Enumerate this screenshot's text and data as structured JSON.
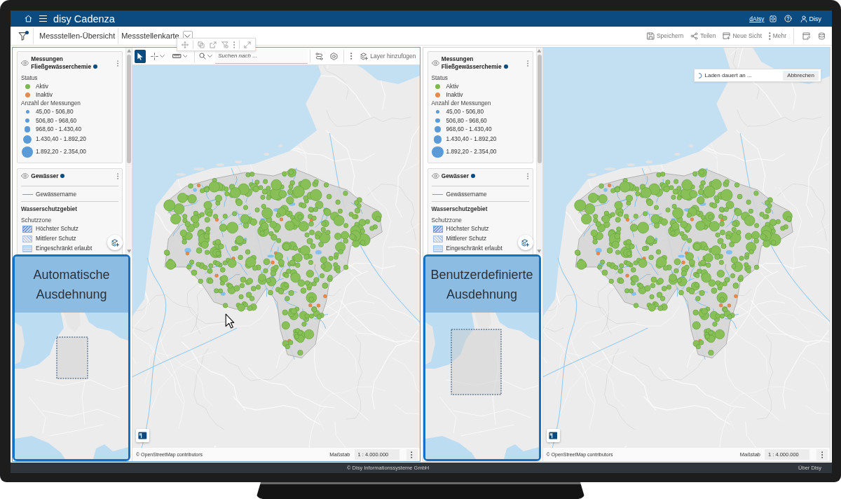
{
  "app_bar": {
    "title": "disy Cadenza",
    "assistant_link": "dAIsy",
    "user": "Disy"
  },
  "toolbar": {
    "filter_active": true,
    "breadcrumbs": [
      {
        "label": "Messstellen-Übersicht"
      },
      {
        "label": "Messstellenkarte"
      }
    ],
    "actions": [
      {
        "kind": "save",
        "label": "Speichern"
      },
      {
        "kind": "share",
        "label": "Teilen"
      },
      {
        "kind": "newview",
        "label": "Neue Sicht"
      },
      {
        "kind": "more",
        "label": "Mehr"
      }
    ]
  },
  "panels": [
    {
      "selected": true,
      "legend": [
        {
          "title": "Messungen Fließgewässerchemie",
          "visible": true,
          "status_dot": true,
          "sections": [
            {
              "title": "Status",
              "items": [
                {
                  "kind": "point",
                  "label": "Aktiv",
                  "color": "#7cb850"
                },
                {
                  "kind": "point",
                  "label": "Inaktiv",
                  "color": "#e98a48"
                }
              ]
            },
            {
              "title": "Anzahl der Messungen",
              "items": [
                {
                  "kind": "size",
                  "label": "45,00 - 506,80"
                },
                {
                  "kind": "size",
                  "label": "506,80 - 968,60"
                },
                {
                  "kind": "size",
                  "label": "968,60 - 1.430,40"
                },
                {
                  "kind": "size",
                  "label": "1.430,40 - 1.892,20"
                },
                {
                  "kind": "size",
                  "label": "1.892,20 - 2.354,00"
                }
              ]
            }
          ]
        },
        {
          "title": "Gewässer",
          "visible": true,
          "status_dot": true,
          "sublayers": [
            {
              "sections": [
                {
                  "items": [
                    {
                      "kind": "line",
                      "label": "Gewässername"
                    }
                  ]
                }
              ]
            },
            {
              "title": "Wasserschutzgebiet",
              "sections": [
                {
                  "title": "Schutzzone",
                  "items": [
                    {
                      "kind": "hatch",
                      "label": "Höchster Schutz"
                    },
                    {
                      "kind": "backhatch",
                      "label": "Mittlerer Schutz"
                    },
                    {
                      "kind": "stripes",
                      "label": "Eingeschränkt erlaubt"
                    }
                  ]
                }
              ]
            }
          ]
        }
      ],
      "map_toolbar": {
        "tools": [
          {
            "kind": "select",
            "selected": true
          },
          {
            "kind": "point",
            "selected": false
          },
          {
            "kind": "measure",
            "selected": false
          }
        ],
        "search": {
          "placeholder": "Suchen nach ..."
        },
        "add_layer": "Layer hinzufügen"
      },
      "overview": {
        "kind": "automatic",
        "caption": "Automatische Ausdehnung"
      },
      "attribution": "© OpenStreetMap contributors",
      "scale": {
        "label": "Maßstab",
        "value": "1 : 4.000.000"
      }
    },
    {
      "selected": false,
      "legend": [
        {
          "title": "Messungen Fließgewässerchemie",
          "visible": true,
          "status_dot": true,
          "sections": [
            {
              "title": "Status",
              "items": [
                {
                  "kind": "point",
                  "label": "Aktiv",
                  "color": "#7cb850"
                },
                {
                  "kind": "point",
                  "label": "Inaktiv",
                  "color": "#e98a48"
                }
              ]
            },
            {
              "title": "Anzahl der Messungen",
              "items": [
                {
                  "kind": "size",
                  "label": "45,00 - 506,80"
                },
                {
                  "kind": "size",
                  "label": "506,80 - 968,60"
                },
                {
                  "kind": "size",
                  "label": "968,60 - 1.430,40"
                },
                {
                  "kind": "size",
                  "label": "1.430,40 - 1.892,20"
                },
                {
                  "kind": "size",
                  "label": "1.892,20 - 2.354,00"
                }
              ]
            }
          ]
        },
        {
          "title": "Gewässer",
          "visible": true,
          "status_dot": true,
          "sublayers": [
            {
              "sections": [
                {
                  "items": [
                    {
                      "kind": "line",
                      "label": "Gewässername"
                    }
                  ]
                }
              ]
            },
            {
              "title": "Wasserschutzgebiet",
              "sections": [
                {
                  "title": "Schutzzone",
                  "items": [
                    {
                      "kind": "hatch",
                      "label": "Höchster Schutz"
                    },
                    {
                      "kind": "backhatch",
                      "label": "Mittlerer Schutz"
                    },
                    {
                      "kind": "stripes",
                      "label": "Eingeschränkt erlaubt"
                    }
                  ]
                }
              ]
            }
          ]
        }
      ],
      "loading": {
        "message": "Laden dauert an ...",
        "button": "Abbrechen"
      },
      "overview": {
        "kind": "custom",
        "caption": "Benutzerdefinierte Ausdehnung"
      },
      "attribution": "© OpenStreetMap contributors",
      "scale": {
        "label": "Maßstab",
        "value": "1 : 4.000.000"
      }
    }
  ],
  "footer": {
    "copyright": "© Disy Informationssysteme GmbH",
    "link": "Über Disy"
  }
}
